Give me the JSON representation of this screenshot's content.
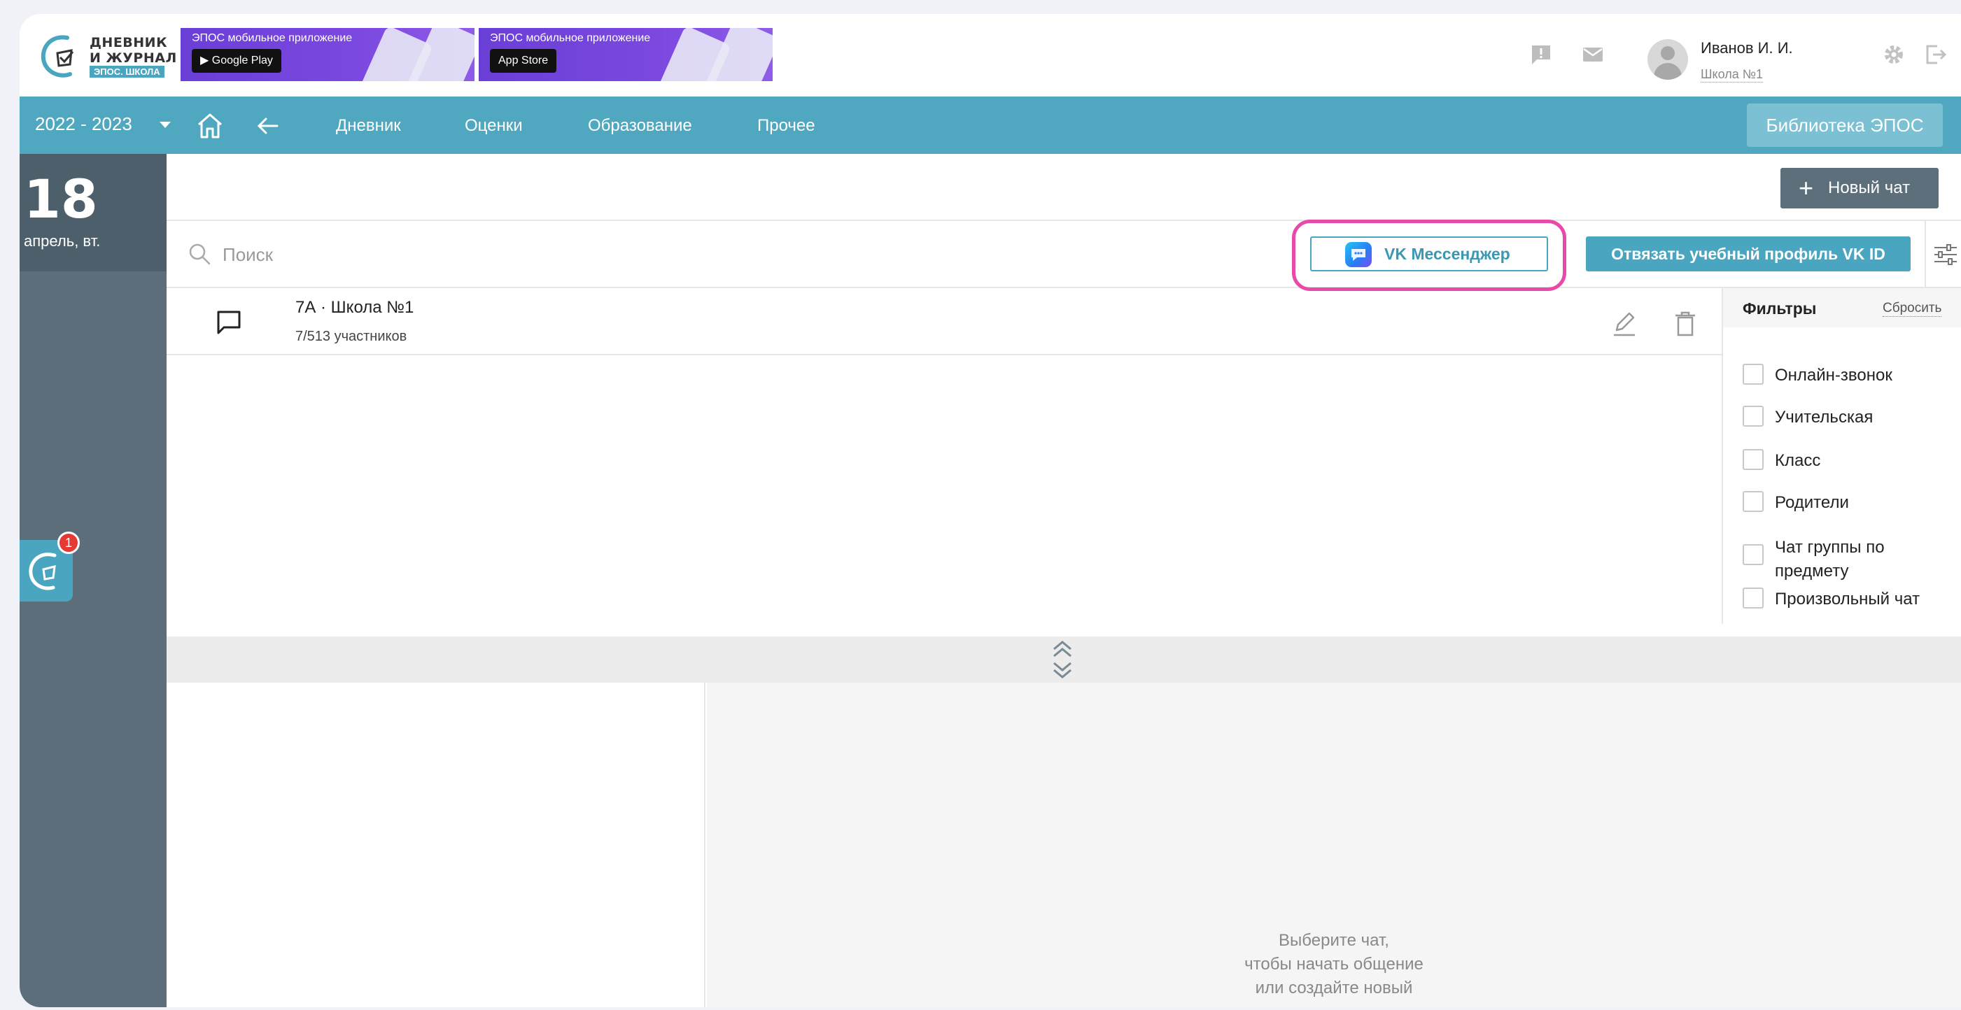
{
  "logo": {
    "line1": "ДНЕВНИК",
    "line2": "И ЖУРНАЛ",
    "line3": "ЭПОС. ШКОЛА"
  },
  "banners": [
    {
      "title": "ЭПОС мобильное приложение",
      "store": "Google Play"
    },
    {
      "title": "ЭПОС мобильное приложение",
      "store": "App Store"
    }
  ],
  "user": {
    "name": "Иванов И. И.",
    "school": "Школа №1"
  },
  "nav": {
    "year": "2022 - 2023",
    "links": [
      "Дневник",
      "Оценки",
      "Образование",
      "Прочее"
    ],
    "library": "Библиотека ЭПОС"
  },
  "date": {
    "day": "18",
    "label": "апрель, вт."
  },
  "helper": {
    "badge": "1"
  },
  "toolbar": {
    "new_chat": "Новый чат"
  },
  "search": {
    "placeholder": "Поиск"
  },
  "vk": {
    "messenger": "VK Мессенджер",
    "unlink": "Отвязать учебный профиль VK ID",
    "highlight_color": "#e74aa8"
  },
  "chats": [
    {
      "name": "7А · Школа №1",
      "members": "7/513 участников"
    }
  ],
  "filters": {
    "title": "Фильтры",
    "reset": "Сбросить",
    "items": [
      "Онлайн-звонок",
      "Учительская",
      "Класс",
      "Родители",
      "Чат группы по предмету",
      "Произвольный чат"
    ]
  },
  "empty": {
    "message": "Выберите чат,\nчтобы начать общение\nили создайте новый"
  },
  "colors": {
    "accent": "#4fa7c0",
    "sidebar": "#5b6e79",
    "banner": "#6a3fd6"
  }
}
